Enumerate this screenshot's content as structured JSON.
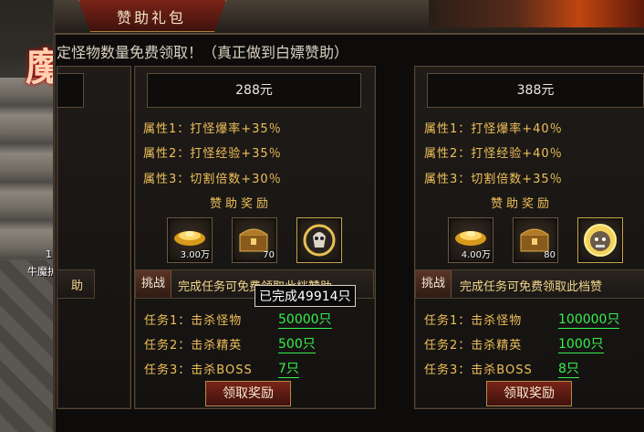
{
  "window": {
    "title": "赞助礼包"
  },
  "background": {
    "logo_text": "魔",
    "player_level": "1",
    "player_name": "牛魔护"
  },
  "notice": "定怪物数量免费领取！（真正做到白嫖赞助）",
  "left_partial": {
    "button_text": "助"
  },
  "tiers": [
    {
      "price": "288元",
      "props": [
        "属性1：打怪爆率+35％",
        "属性2：打怪经验+35％",
        "属性3：切割倍数+30％"
      ],
      "reward_title": "赞助奖励",
      "rewards": [
        {
          "icon": "gold-ingot-icon",
          "count": "3.00万"
        },
        {
          "icon": "treasure-chest-icon",
          "count": "70"
        },
        {
          "icon": "skull-badge-icon",
          "count": ""
        }
      ],
      "challenge_label": "挑战",
      "challenge_text": "完成任务可免费领取此档赞助",
      "tooltip": "已完成49914只",
      "tasks": [
        {
          "label": "任务1：击杀怪物",
          "value": "50000只"
        },
        {
          "label": "任务2：击杀精英",
          "value": "500只"
        },
        {
          "label": "任务3：击杀BOSS",
          "value": "7只"
        }
      ],
      "claim_label": "领取奖励"
    },
    {
      "price": "388元",
      "props": [
        "属性1：打怪爆率+40％",
        "属性2：打怪经验+40％",
        "属性3：切割倍数+35％"
      ],
      "reward_title": "赞助奖励",
      "rewards": [
        {
          "icon": "gold-ingot-icon",
          "count": "4.00万"
        },
        {
          "icon": "treasure-chest-icon",
          "count": "80"
        },
        {
          "icon": "beast-head-icon",
          "count": ""
        }
      ],
      "challenge_label": "挑战",
      "challenge_text": "完成任务可免费领取此档赞",
      "tasks": [
        {
          "label": "任务1：击杀怪物",
          "value": "100000只"
        },
        {
          "label": "任务2：击杀精英",
          "value": "1000只"
        },
        {
          "label": "任务3：击杀BOSS",
          "value": "8只"
        }
      ],
      "claim_label": "领取奖励"
    }
  ],
  "colors": {
    "gold_text": "#f0c05a",
    "progress_green": "#36f14b",
    "button_red": "#7a2419"
  }
}
